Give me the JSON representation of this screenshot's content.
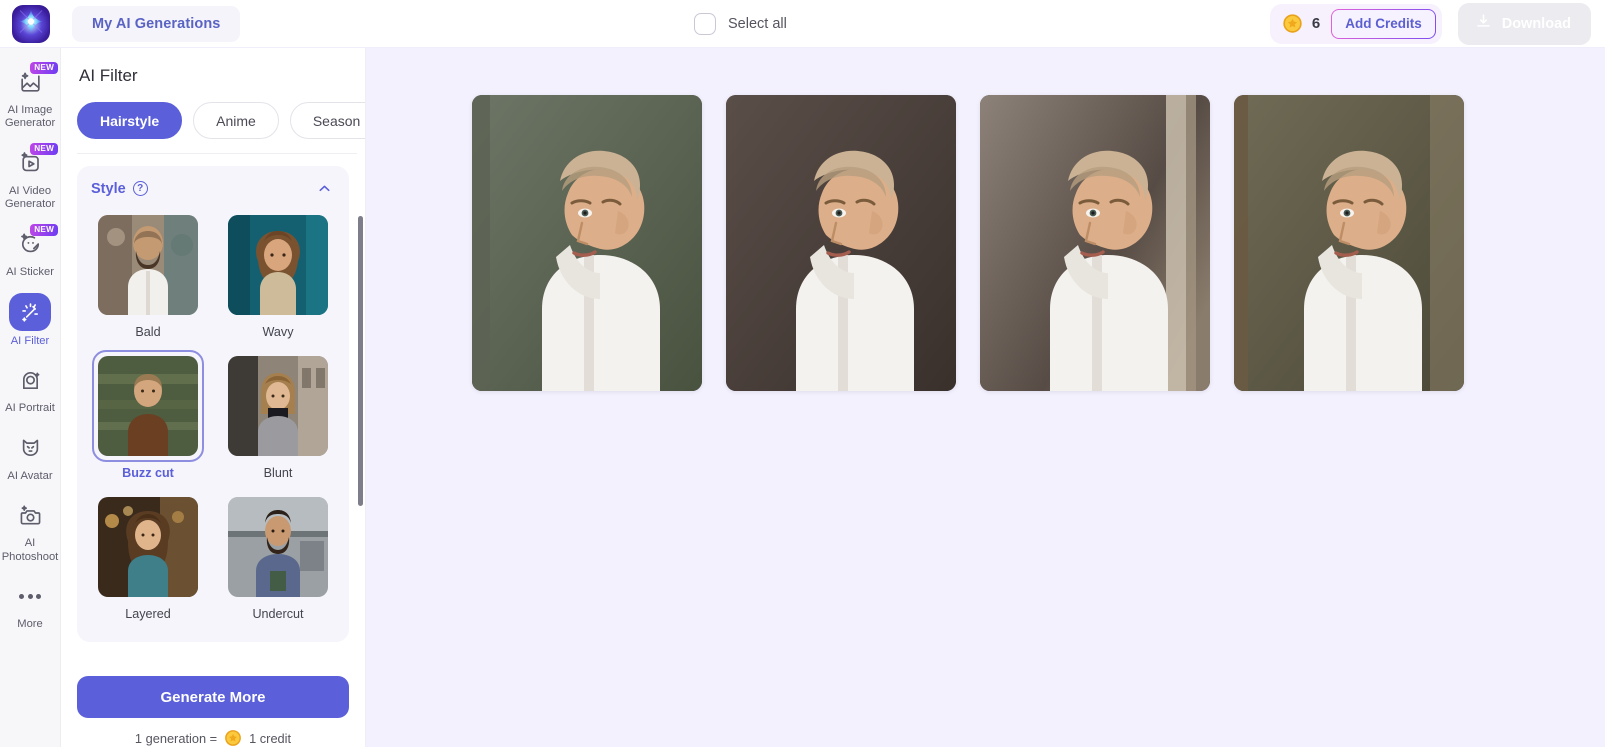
{
  "app": {
    "logo_icon": "starburst-logo-icon",
    "my_generations_label": "My AI Generations"
  },
  "header": {
    "select_all_label": "Select all",
    "select_all_checked": false,
    "credits": {
      "coin_icon": "coin-icon",
      "count": "6",
      "add_credits_label": "Add Credits"
    },
    "download": {
      "icon": "download-icon",
      "label": "Download",
      "disabled": true
    }
  },
  "sidebar": {
    "items": [
      {
        "label": "AI Image Generator",
        "icon": "image-sparkle-icon",
        "badge": "NEW",
        "active": false
      },
      {
        "label": "AI Video Generator",
        "icon": "video-play-sparkle-icon",
        "badge": "NEW",
        "active": false
      },
      {
        "label": "AI Sticker",
        "icon": "sticker-smiley-icon",
        "badge": "NEW",
        "active": false
      },
      {
        "label": "AI Filter",
        "icon": "magic-wand-sparkle-icon",
        "badge": "",
        "active": true
      },
      {
        "label": "AI Portrait",
        "icon": "portrait-frame-icon",
        "badge": "",
        "active": false
      },
      {
        "label": "AI Avatar",
        "icon": "avatar-cat-icon",
        "badge": "",
        "active": false
      },
      {
        "label": "AI Photoshoot",
        "icon": "camera-sparkle-icon",
        "badge": "",
        "active": false
      },
      {
        "label": "More",
        "icon": "more-dots-icon",
        "badge": "",
        "active": false
      }
    ]
  },
  "panel": {
    "title": "AI Filter",
    "tabs": [
      {
        "label": "Hairstyle",
        "active": true
      },
      {
        "label": "Anime",
        "active": false
      },
      {
        "label": "Season",
        "active": false
      }
    ],
    "style_section": {
      "title": "Style",
      "help_icon": "question-mark-icon",
      "collapse_icon": "chevron-up-icon",
      "expanded": true,
      "items": [
        {
          "name": "Bald",
          "selected": false,
          "thumb": "bald-man-white-shirt"
        },
        {
          "name": "Wavy",
          "selected": false,
          "thumb": "wavy-hair-woman-teal"
        },
        {
          "name": "Buzz cut",
          "selected": true,
          "thumb": "buzz-cut-man-brown-shirt"
        },
        {
          "name": "Blunt",
          "selected": false,
          "thumb": "blunt-bob-woman-grey"
        },
        {
          "name": "Layered",
          "selected": false,
          "thumb": "layered-hair-woman-teal"
        },
        {
          "name": "Undercut",
          "selected": false,
          "thumb": "undercut-man-blue-shirt"
        }
      ]
    },
    "generate_button_label": "Generate More",
    "credit_note": {
      "prefix": "1 generation =",
      "coin_icon": "coin-icon",
      "suffix": "1 credit"
    },
    "scrollbar": "panel-scrollbar"
  },
  "canvas": {
    "results": [
      {
        "alt": "buzz-cut-portrait-green-background",
        "bg": "#6d7566",
        "bg2": "#49523f"
      },
      {
        "alt": "buzz-cut-portrait-dark-grey-background",
        "bg": "#4f443f",
        "bg2": "#3a312d"
      },
      {
        "alt": "buzz-cut-portrait-warm-grey-background",
        "bg": "#7e736b",
        "bg2": "#554c46"
      },
      {
        "alt": "buzz-cut-portrait-olive-background",
        "bg": "#6f6a56",
        "bg2": "#4b4737"
      }
    ]
  },
  "colors": {
    "accent": "#5b5fd9",
    "canvas_bg": "#f3f1fd",
    "rail_bg": "#f7f7fa",
    "badge_gradient_from": "#c046e8",
    "badge_gradient_to": "#6d3df2"
  }
}
